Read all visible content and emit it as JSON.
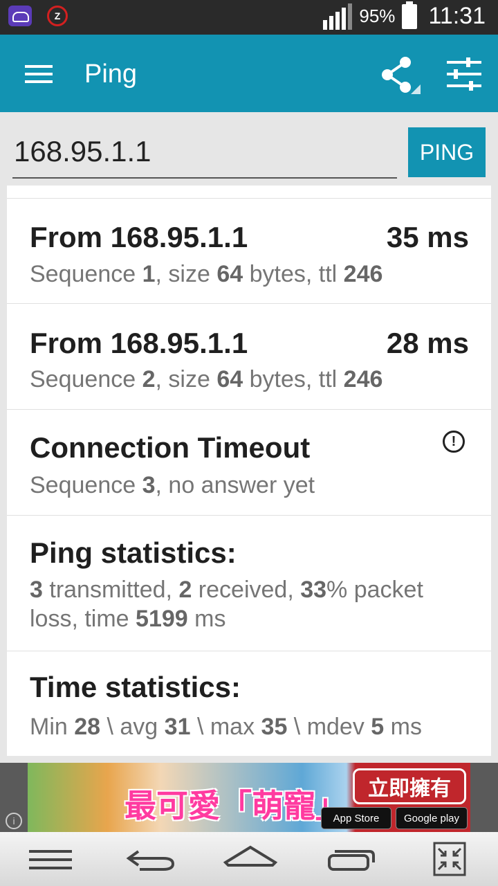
{
  "status_bar": {
    "battery_percent": "95%",
    "time": "11:31",
    "alarm_glyph": "Z",
    "icons": [
      "cloud-notification-icon",
      "alarm-icon",
      "signal-icon",
      "battery-icon"
    ]
  },
  "app_bar": {
    "title": "Ping",
    "icons": [
      "menu-icon",
      "share-icon",
      "tune-icon"
    ],
    "color": "#1293b2"
  },
  "input": {
    "value": "168.95.1.1",
    "button_label": "PING"
  },
  "replies": [
    {
      "title": "From 168.95.1.1",
      "time": "35 ms",
      "seq_label": "Sequence ",
      "seq": "1",
      "size_label": ", size ",
      "size": "64",
      "ttl_label": " bytes, ttl ",
      "ttl": "246"
    },
    {
      "title": "From 168.95.1.1",
      "time": "28 ms",
      "seq_label": "Sequence ",
      "seq": "2",
      "size_label": ", size ",
      "size": "64",
      "ttl_label": " bytes, ttl ",
      "ttl": "246"
    }
  ],
  "timeout": {
    "title": "Connection Timeout",
    "seq_label": "Sequence ",
    "seq": "3",
    "suffix": ", no answer yet",
    "icon_glyph": "!"
  },
  "ping_stats": {
    "title": "Ping statistics:",
    "transmitted": "3",
    "transmitted_label": " transmitted, ",
    "received": "2",
    "received_label": " received, ",
    "loss": "33",
    "loss_label": "% packet",
    "line2_label": "loss, time ",
    "time": "5199",
    "time_unit": " ms"
  },
  "time_stats": {
    "title": "Time statistics:",
    "min_label": "Min ",
    "min": "28",
    "avg_label": " \\ avg ",
    "avg": "31",
    "max_label": " \\ max ",
    "max": "35",
    "mdev_label": " \\ mdev ",
    "mdev": "5",
    "unit": " ms"
  },
  "ad": {
    "main_text": "最可愛「萌寵」",
    "cta": "立即擁有",
    "app_store": "App Store",
    "google_play": "Google play",
    "info_glyph": "i"
  },
  "nav_bar": {
    "buttons": [
      "menu-button",
      "back-button",
      "home-button",
      "recents-button",
      "fullscreen-button"
    ]
  }
}
